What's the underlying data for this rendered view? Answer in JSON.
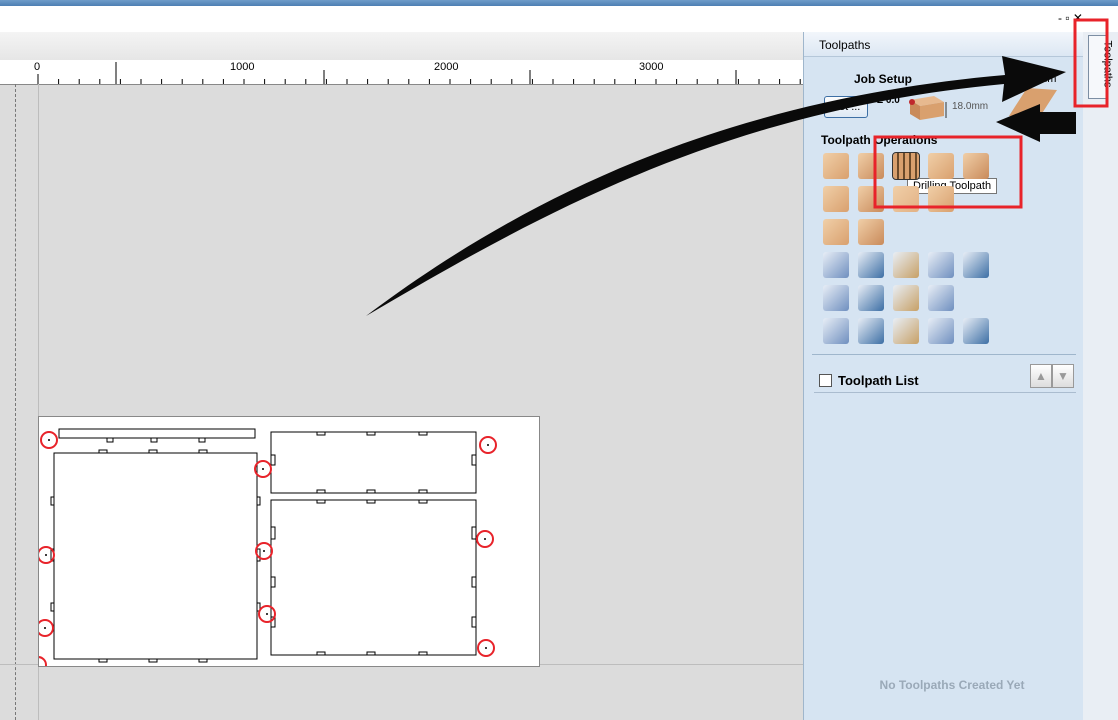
{
  "ruler": {
    "labels": [
      "0",
      "1000",
      "2000",
      "3000"
    ]
  },
  "panel": {
    "title": "Toolpaths",
    "job_setup_label": "Job Setup",
    "set_button": "Set ...",
    "zero_label": "Z 0.0",
    "thickness": "18.0mm",
    "datum_label": "Datum",
    "operations_label": "Toolpath Operations",
    "tooltip": "Drilling Toolpath",
    "toolpath_list_label": "Toolpath List",
    "empty_message": "No Toolpaths Created Yet"
  },
  "side_tab": {
    "label": "Toolpaths"
  },
  "window_controls": {
    "text": "- ▫ ✕"
  },
  "icons": {
    "row1": [
      "profile-icon",
      "pocket-icon",
      "drilling-icon",
      "texture-icon",
      "inlay-icon"
    ],
    "row2": [
      "vcarve-icon",
      "fluting-icon",
      "prism-icon",
      "moulding-icon"
    ],
    "row3": [
      "3d-roughing-icon",
      "3d-finishing-icon"
    ],
    "row4": [
      "tool-database-icon",
      "edit-toolpath-icon",
      "merge-toolpath-icon",
      "delete-toolpath-icon",
      "gcode-calc-icon"
    ],
    "row5": [
      "preview-all-icon",
      "preview-selected-icon",
      "reset-preview-icon",
      "split-icon"
    ],
    "row6": [
      "material-icon",
      "time-estimate-icon",
      "tabs-icon",
      "save-toolpath-icon",
      "export-icon"
    ]
  },
  "colors": {
    "accent_red": "#e8232a",
    "panel_bg": "#d6e4f2",
    "arrow": "#0a0a0a"
  }
}
